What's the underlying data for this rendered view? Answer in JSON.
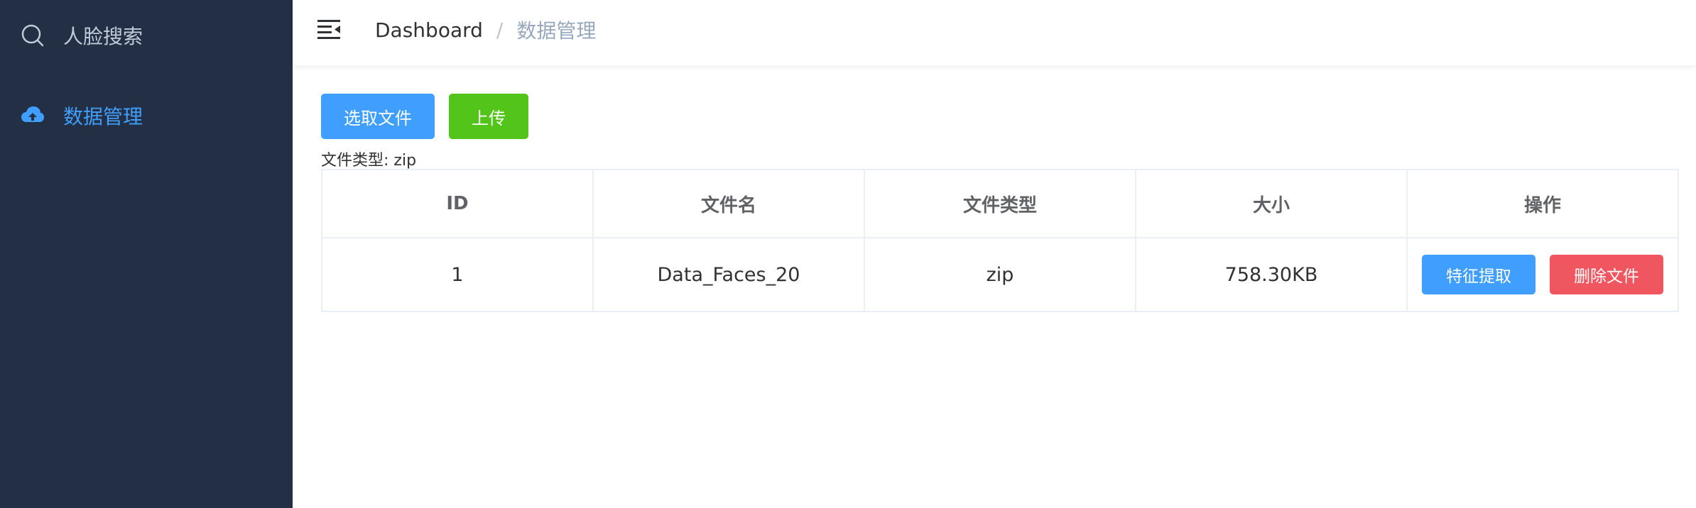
{
  "sidebar": {
    "items": [
      {
        "label": "人脸搜索",
        "icon": "search-icon",
        "active": false
      },
      {
        "label": "数据管理",
        "icon": "cloud-upload-icon",
        "active": true
      }
    ],
    "background": "#232f44",
    "active_color": "#409eff"
  },
  "header": {
    "breadcrumb": {
      "home": "Dashboard",
      "separator": "/",
      "current": "数据管理"
    }
  },
  "toolbar": {
    "select_file_label": "选取文件",
    "upload_label": "上传",
    "file_type_hint": "文件类型: zip"
  },
  "table": {
    "columns": [
      "ID",
      "文件名",
      "文件类型",
      "大小",
      "操作"
    ],
    "rows": [
      {
        "id": "1",
        "name": "Data_Faces_20",
        "type": "zip",
        "size": "758.30KB",
        "extract_label": "特征提取",
        "delete_label": "删除文件"
      }
    ]
  },
  "colors": {
    "primary": "#409eff",
    "success": "#52c41a",
    "danger": "#f0565f"
  }
}
